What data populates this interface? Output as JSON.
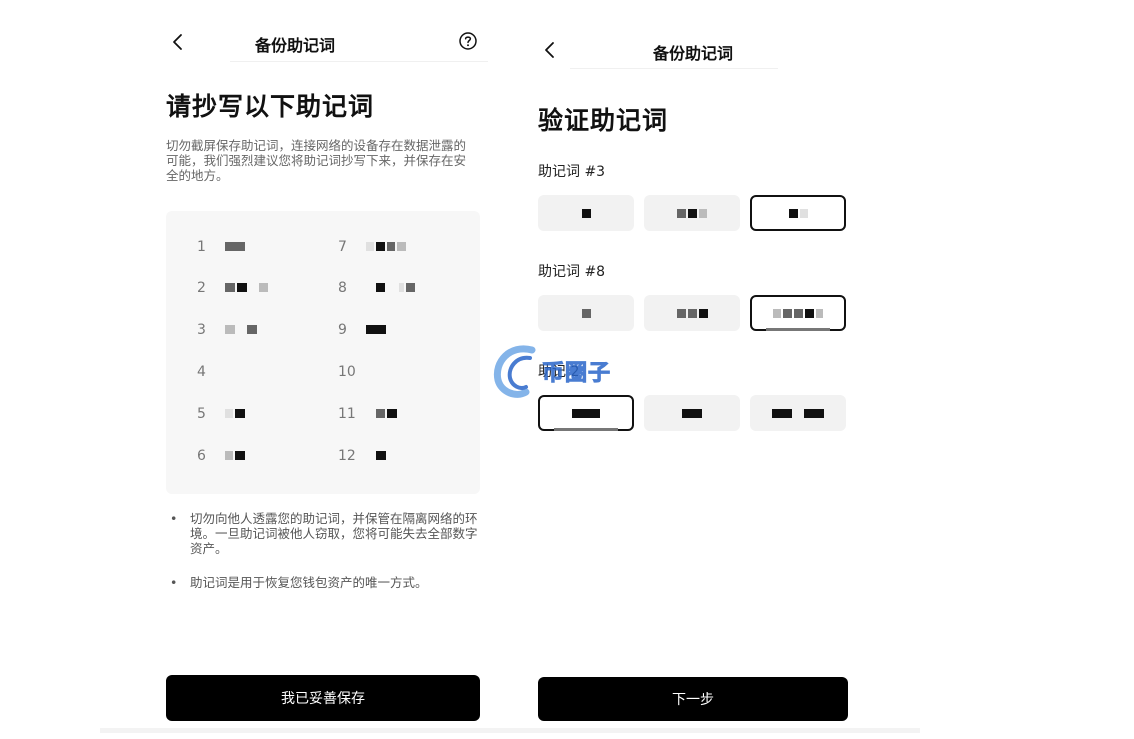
{
  "left": {
    "nav": {
      "title": "备份助记词",
      "back_icon": "chevron-left-icon",
      "help_icon": "question-circle-icon"
    },
    "heading": "请抄写以下助记词",
    "description": "切勿截屏保存助记词，连接网络的设备存在数据泄露的可能，我们强烈建议您将助记词抄写下来，并保存在安全的地方。",
    "words": [
      {
        "num": "1"
      },
      {
        "num": "2"
      },
      {
        "num": "3"
      },
      {
        "num": "4"
      },
      {
        "num": "5"
      },
      {
        "num": "6"
      },
      {
        "num": "7"
      },
      {
        "num": "8"
      },
      {
        "num": "9"
      },
      {
        "num": "10"
      },
      {
        "num": "11"
      },
      {
        "num": "12"
      }
    ],
    "tips": [
      "切勿向他人透露您的助记词，并保管在隔离网络的环境。一旦助记词被他人窃取，您将可能失去全部数字资产。",
      "助记词是用于恢复您钱包资产的唯一方式。"
    ],
    "bullet": "•",
    "confirm_button": "我已妥善保存"
  },
  "right": {
    "nav": {
      "title": "备份助记词",
      "back_icon": "chevron-left-icon"
    },
    "heading": "验证助记词",
    "questions": [
      {
        "label": "助记词 #3",
        "selected_index": 2
      },
      {
        "label": "助记词 #8",
        "selected_index": 2
      },
      {
        "label": "助记 2",
        "selected_index": 0
      }
    ],
    "next_button": "下一步"
  },
  "watermark": {
    "text": "币圈子"
  },
  "colors": {
    "primary": "#000000",
    "card_bg": "#f7f7f7",
    "option_bg": "#f2f2f2",
    "watermark_blue": "#2a66c9"
  }
}
